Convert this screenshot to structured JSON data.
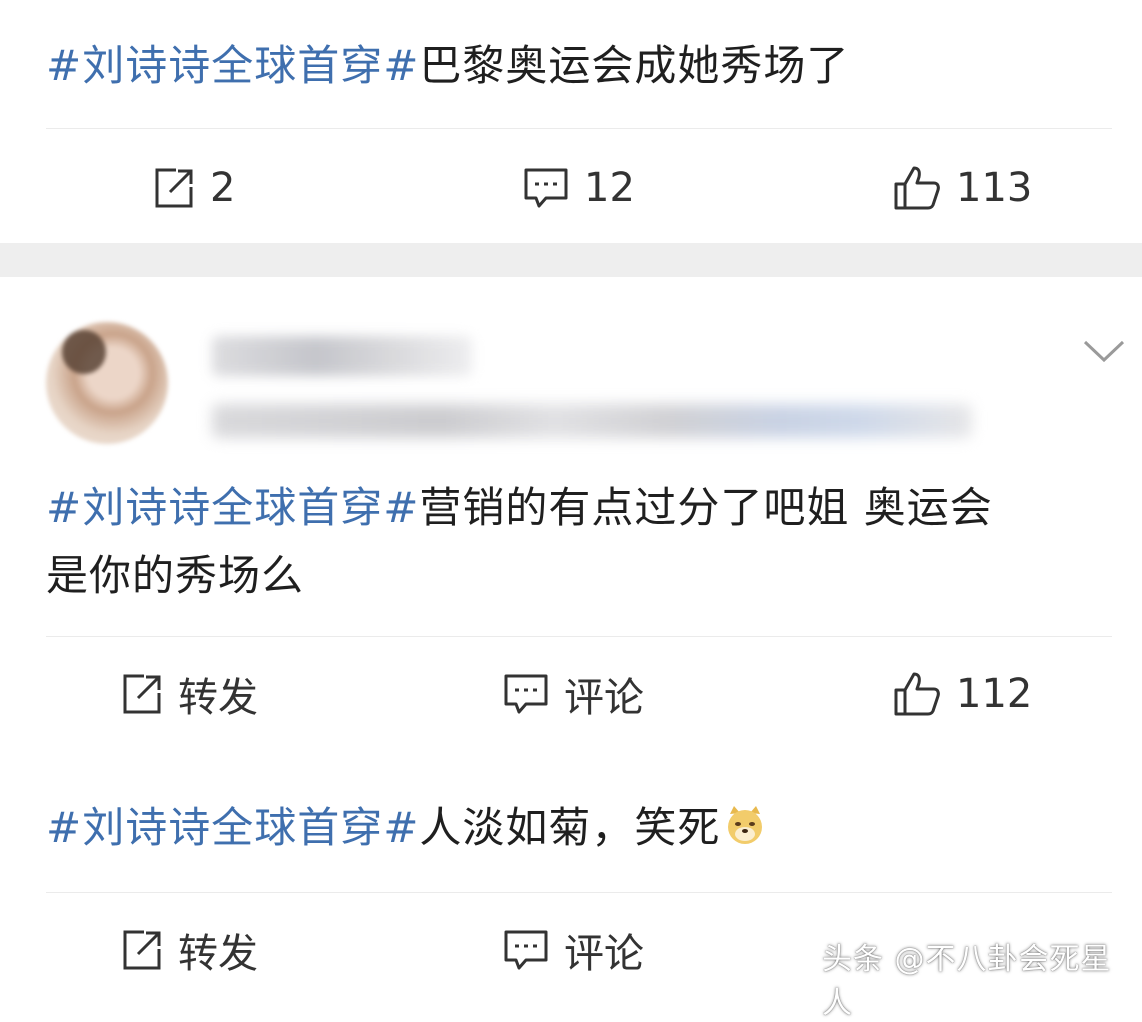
{
  "posts": [
    {
      "topic": "#刘诗诗全球首穿#",
      "text": "巴黎奥运会成她秀场了",
      "repost": "2",
      "comment": "12",
      "like": "113"
    },
    {
      "topic": "#刘诗诗全球首穿#",
      "text_line1": "营销的有点过分了吧姐 奥运会",
      "text_line2": "是你的秀场么",
      "repost": "转发",
      "comment": "评论",
      "like": "112"
    },
    {
      "topic": "#刘诗诗全球首穿#",
      "text": "人淡如菊，笑死",
      "emoji": "doge-icon",
      "repost": "转发",
      "comment": "评论"
    }
  ],
  "watermark": "头条 @不八卦会死星人",
  "colors": {
    "topic": "#3f6fae",
    "text": "#1f1f1f",
    "band": "#eeeeee"
  }
}
